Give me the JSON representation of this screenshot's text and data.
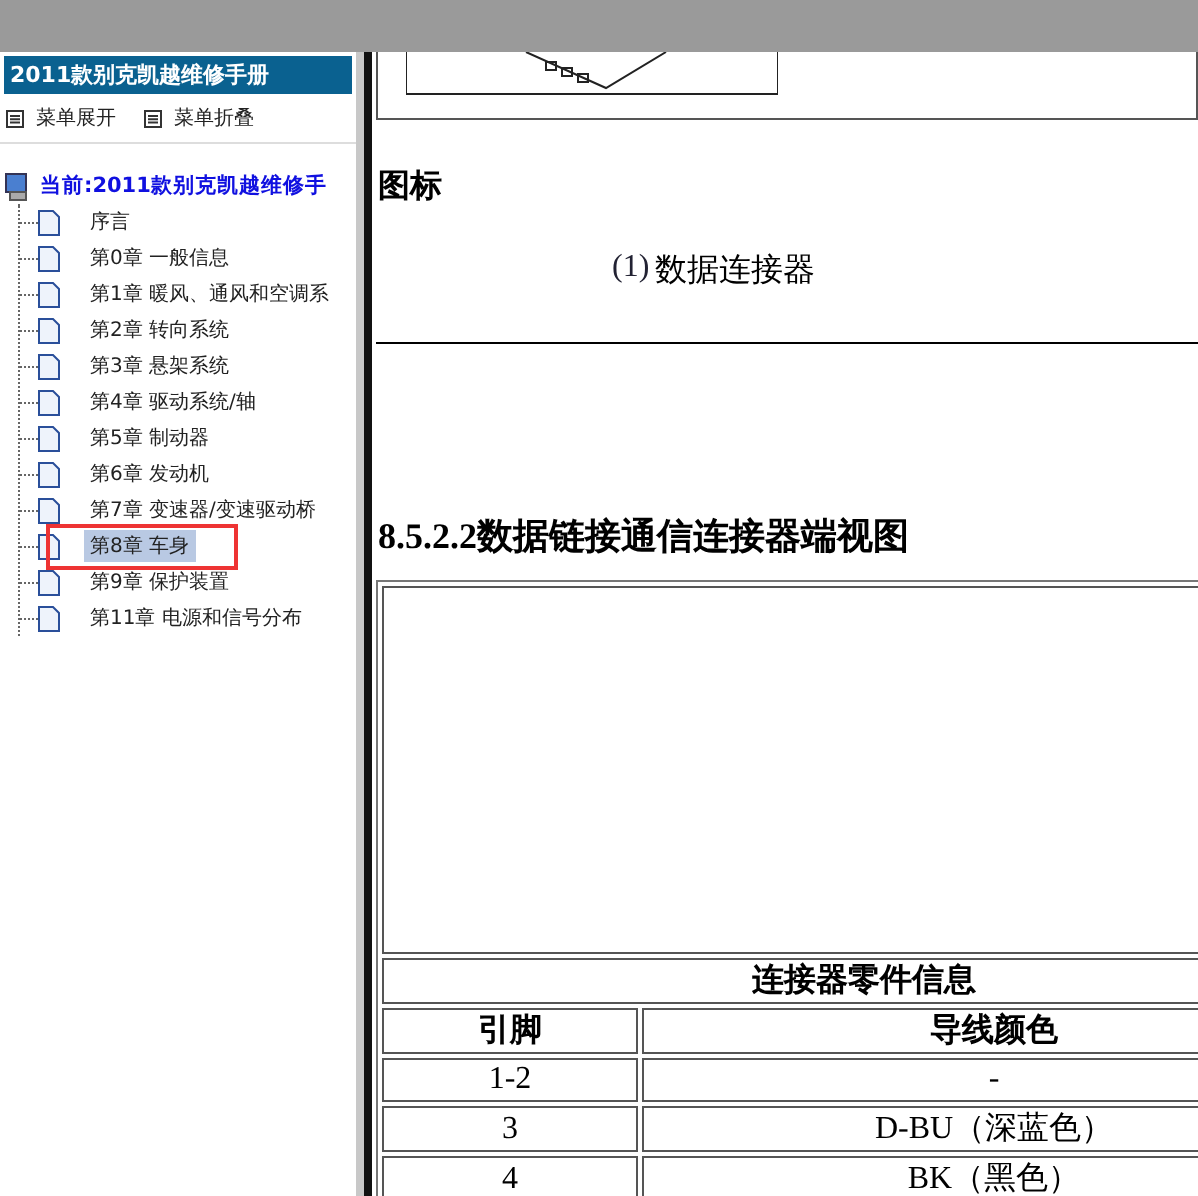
{
  "sidebar": {
    "title": "2011款别克凯越维修手册",
    "menu_actions": [
      {
        "label": "菜单展开"
      },
      {
        "label": "菜单折叠"
      }
    ],
    "tree": {
      "label": "当前:2011款别克凯越维修手",
      "children": [
        {
          "label": "序言",
          "selected": false
        },
        {
          "label": "第0章 一般信息",
          "selected": false
        },
        {
          "label": "第1章 暖风、通风和空调系",
          "selected": false
        },
        {
          "label": "第2章 转向系统",
          "selected": false
        },
        {
          "label": "第3章 悬架系统",
          "selected": false
        },
        {
          "label": "第4章 驱动系统/轴",
          "selected": false
        },
        {
          "label": "第5章 制动器",
          "selected": false
        },
        {
          "label": "第6章 发动机",
          "selected": false
        },
        {
          "label": "第7章 变速器/变速驱动桥",
          "selected": false
        },
        {
          "label": "第8章 车身",
          "selected": true
        },
        {
          "label": "第9章 保护装置",
          "selected": false
        },
        {
          "label": "第11章 电源和信号分布",
          "selected": false
        }
      ]
    }
  },
  "content": {
    "legend_heading": "图标",
    "legend_items": [
      {
        "number": "(1)",
        "text": "数据连接器"
      }
    ],
    "section_heading": "8.5.2.2数据链接通信连接器端视图",
    "table": {
      "caption": "连接器零件信息",
      "columns": [
        "引脚",
        "导线颜色"
      ],
      "rows": [
        [
          "1-2",
          "-"
        ],
        [
          "3",
          "D-BU（深蓝色）"
        ],
        [
          "4",
          "BK（黑色）"
        ]
      ]
    }
  }
}
